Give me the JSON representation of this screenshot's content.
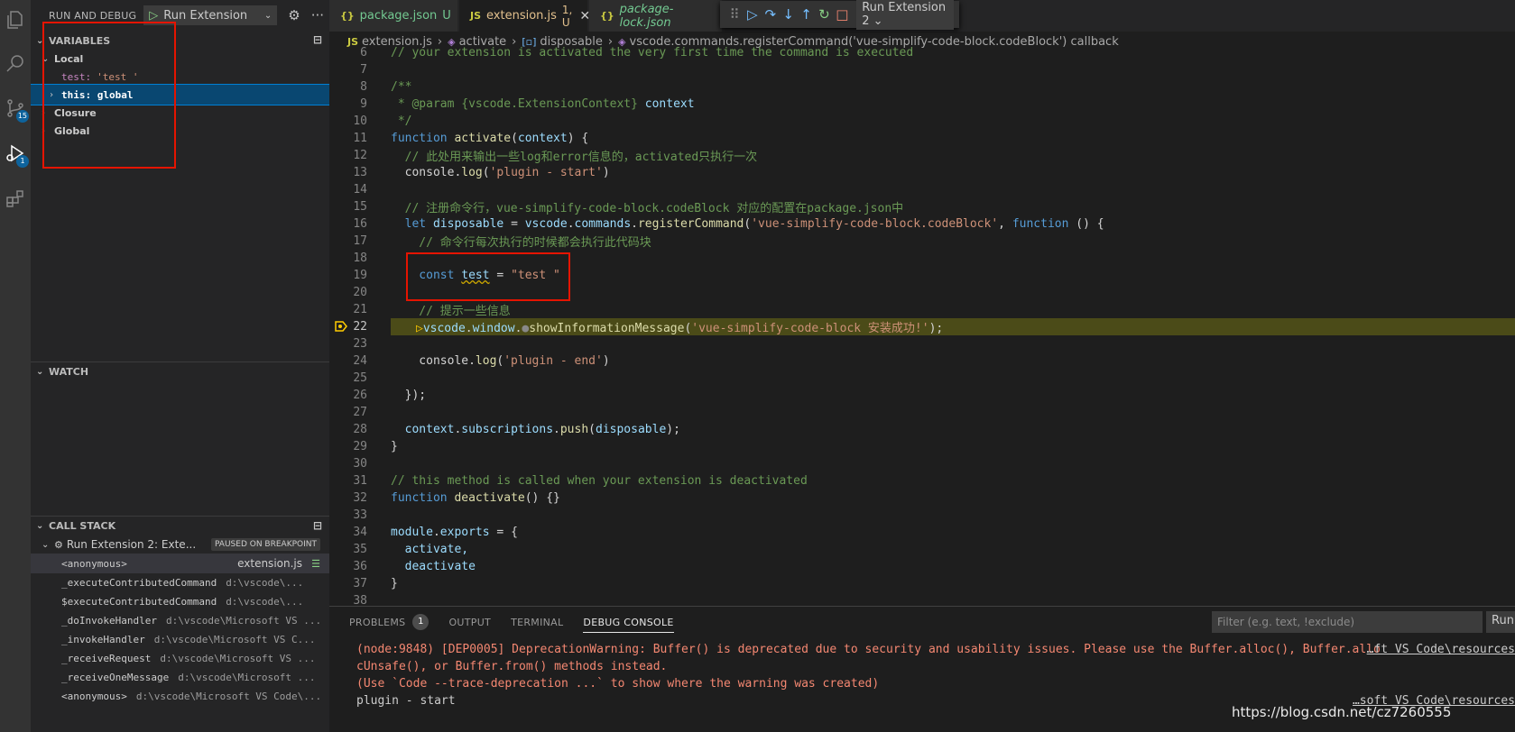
{
  "activity_bar": {
    "source_control_badge": "15",
    "debug_badge": "1"
  },
  "sidebar": {
    "header_title": "RUN AND DEBUG",
    "launch_config": "Run Extension",
    "variables": {
      "title": "VARIABLES",
      "local_label": "Local",
      "local_var_name": "test:",
      "local_var_value": "'test '",
      "this_label": "this: global",
      "closure_label": "Closure",
      "global_label": "Global"
    },
    "watch_title": "WATCH",
    "call_stack": {
      "title": "CALL STACK",
      "thread_label": "Run Extension 2: Exte...",
      "paused_badge": "PAUSED ON BREAKPOINT",
      "frames": [
        {
          "fn": "<anonymous>",
          "file": "extension.js"
        },
        {
          "fn": "_executeContributedCommand",
          "file": "d:\\vscode\\..."
        },
        {
          "fn": "$executeContributedCommand",
          "file": "d:\\vscode\\..."
        },
        {
          "fn": "_doInvokeHandler",
          "file": "d:\\vscode\\Microsoft VS ..."
        },
        {
          "fn": "_invokeHandler",
          "file": "d:\\vscode\\Microsoft VS C..."
        },
        {
          "fn": "_receiveRequest",
          "file": "d:\\vscode\\Microsoft VS ..."
        },
        {
          "fn": "_receiveOneMessage",
          "file": "d:\\vscode\\Microsoft ..."
        },
        {
          "fn": "<anonymous>",
          "file": "d:\\vscode\\Microsoft VS Code\\..."
        }
      ]
    }
  },
  "tabs": [
    {
      "icon": "{}",
      "name": "package.json",
      "status": "U"
    },
    {
      "icon": "JS",
      "name": "extension.js",
      "status": "1, U"
    },
    {
      "icon": "{}",
      "name": "package-lock.json",
      "status": ""
    }
  ],
  "debug_toolbar": {
    "session": "Run Extension 2"
  },
  "breadcrumb": [
    "extension.js",
    "activate",
    "disposable",
    "vscode.commands.registerCommand('vue-simplify-code-block.codeBlock') callback"
  ],
  "code": {
    "line_numbers": [
      "6",
      "7",
      "8",
      "9",
      "10",
      "11",
      "12",
      "13",
      "14",
      "15",
      "16",
      "17",
      "18",
      "19",
      "20",
      "21",
      "22",
      "23",
      "24",
      "25",
      "26",
      "27",
      "28",
      "29",
      "30",
      "31",
      "32",
      "33",
      "34",
      "35",
      "36",
      "37",
      "38"
    ],
    "l6": "// your extension is activated the very first time the command is executed",
    "l8": "/**",
    "l9a": " * @param ",
    "l9b": "{vscode.ExtensionContext}",
    "l9c": " context",
    "l10": " */",
    "l11a": "function ",
    "l11b": "activate",
    "l11c": "(",
    "l11d": "context",
    "l11e": ") {",
    "l12": "  // 此处用来输出一些log和error信息的，activated只执行一次",
    "l13a": "  console.",
    "l13b": "log",
    "l13c": "(",
    "l13d": "'plugin - start'",
    "l13e": ")",
    "l15": "  // 注册命令行，vue-simplify-code-block.codeBlock 对应的配置在package.json中",
    "l16a": "  let ",
    "l16b": "disposable",
    "l16c": " = ",
    "l16d": "vscode",
    "l16e": ".",
    "l16f": "commands",
    "l16g": ".",
    "l16h": "registerCommand",
    "l16i": "(",
    "l16j": "'vue-simplify-code-block.codeBlock'",
    "l16k": ", ",
    "l16l": "function",
    "l16m": " () {",
    "l17": "    // 命令行每次执行的时候都会执行此代码块",
    "l19a": "    const ",
    "l19b": "test",
    "l19c": " = ",
    "l19d": "\"test \"",
    "l21": "    // 提示一些信息",
    "l22a": "vscode",
    "l22b": ".",
    "l22c": "window",
    "l22d": ".",
    "l22e": "showInformationMessage",
    "l22f": "(",
    "l22g": "'vue-simplify-code-block 安装成功!'",
    "l22h": ");",
    "l24a": "    console.",
    "l24b": "log",
    "l24c": "(",
    "l24d": "'plugin - end'",
    "l24e": ")",
    "l26": "  });",
    "l28a": "  context",
    "l28b": ".",
    "l28c": "subscriptions",
    "l28d": ".",
    "l28e": "push",
    "l28f": "(",
    "l28g": "disposable",
    "l28h": ");",
    "l29": "}",
    "l31": "// this method is called when your extension is deactivated",
    "l32a": "function ",
    "l32b": "deactivate",
    "l32c": "() {}",
    "l34a": "module",
    "l34b": ".",
    "l34c": "exports",
    "l34d": " = {",
    "l35": "  activate,",
    "l36": "  deactivate",
    "l37": "}"
  },
  "panel": {
    "tabs": [
      "PROBLEMS",
      "OUTPUT",
      "TERMINAL",
      "DEBUG CONSOLE"
    ],
    "problems_count": "1",
    "filter_placeholder": "Filter (e.g. text, !exclude)",
    "run_label": "Run",
    "output": [
      "(node:9848) [DEP0005] DeprecationWarning: Buffer() is deprecated due to security and usability issues. Please use the Buffer.alloc(), Buffer.allo",
      "cUnsafe(), or Buffer.from() methods instead.",
      "(Use `Code --trace-deprecation ...` to show where the warning was created)",
      "plugin - start"
    ],
    "output_link_1": "…ft VS Code\\resources",
    "output_link_2": "…soft VS Code\\resources"
  },
  "watermark": "https://blog.csdn.net/cz7260555"
}
